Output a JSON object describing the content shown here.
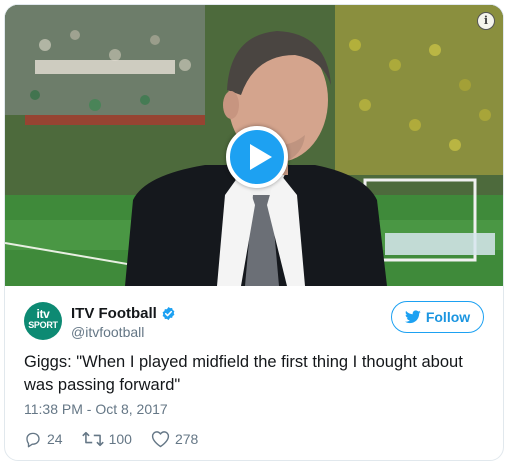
{
  "media": {
    "info_icon": "info-icon",
    "play_icon": "play-icon"
  },
  "author": {
    "avatar_line1": "itv",
    "avatar_line2": "SPORT",
    "display_name": "ITV Football",
    "handle": "@itvfootball",
    "verified": true
  },
  "follow": {
    "label": "Follow"
  },
  "tweet": {
    "text": "Giggs: \"When I played midfield the first thing I thought about was passing forward\"",
    "timestamp": "11:38 PM - Oct 8, 2017"
  },
  "actions": {
    "replies": "24",
    "retweets": "100",
    "likes": "278"
  },
  "colors": {
    "accent": "#1da1f2",
    "text": "#14171a",
    "muted": "#657786"
  }
}
